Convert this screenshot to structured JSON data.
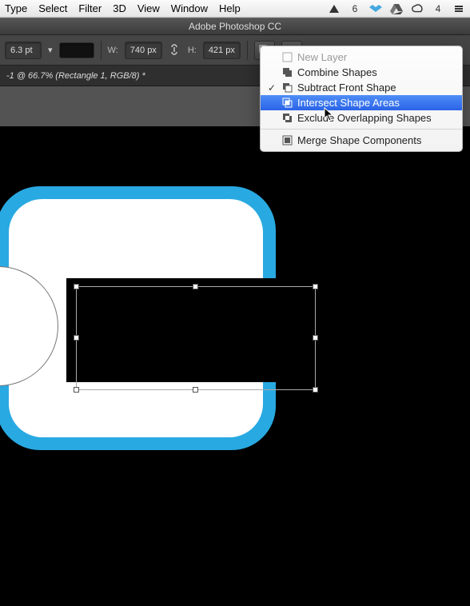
{
  "mac_menu": {
    "items": [
      "Type",
      "Select",
      "Filter",
      "3D",
      "View",
      "Window",
      "Help"
    ],
    "status": {
      "notif_label": "6",
      "battery_label": "4"
    }
  },
  "app": {
    "title": "Adobe Photoshop CC"
  },
  "options": {
    "stroke_width": "6.3 pt",
    "w_label": "W:",
    "width": "740 px",
    "h_label": "H:",
    "height": "421 px"
  },
  "document": {
    "tab": "-1 @ 66.7% (Rectangle 1, RGB/8) *"
  },
  "path_menu": {
    "items": [
      {
        "label": "New Layer",
        "checked": false
      },
      {
        "label": "Combine Shapes",
        "checked": false
      },
      {
        "label": "Subtract Front Shape",
        "checked": true
      },
      {
        "label": "Intersect Shape Areas",
        "checked": false,
        "highlight": true
      },
      {
        "label": "Exclude Overlapping Shapes",
        "checked": false
      }
    ],
    "merge_label": "Merge Shape Components"
  }
}
